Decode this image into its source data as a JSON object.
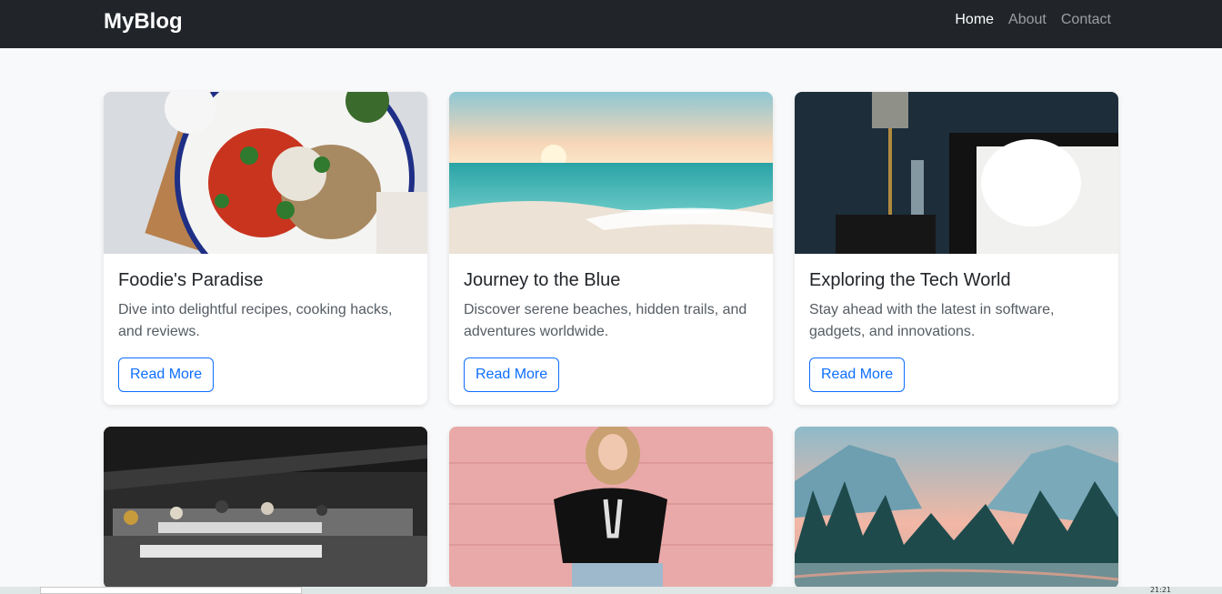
{
  "navbar": {
    "brand": "MyBlog",
    "links": [
      {
        "label": "Home",
        "active": true
      },
      {
        "label": "About",
        "active": false
      },
      {
        "label": "Contact",
        "active": false
      }
    ]
  },
  "cards": [
    {
      "title": "Foodie's Paradise",
      "text": "Dive into delightful recipes, cooking hacks, and reviews.",
      "button": "Read More",
      "image": "salad-bowl-photo"
    },
    {
      "title": "Journey to the Blue",
      "text": "Discover serene beaches, hidden trails, and adventures worldwide.",
      "button": "Read More",
      "image": "beach-sunset-photo"
    },
    {
      "title": "Exploring the Tech World",
      "text": "Stay ahead with the latest in software, gadgets, and innovations.",
      "button": "Read More",
      "image": "bedroom-lamp-photo"
    },
    {
      "image": "office-workspace-photo"
    },
    {
      "image": "woman-pink-wall-photo"
    },
    {
      "image": "mountain-forest-photo"
    }
  ],
  "colors": {
    "navbar": "#212529",
    "accent": "#0d6efd",
    "background": "#f8f9fa"
  },
  "taskbar": {
    "clock": "21:21"
  }
}
